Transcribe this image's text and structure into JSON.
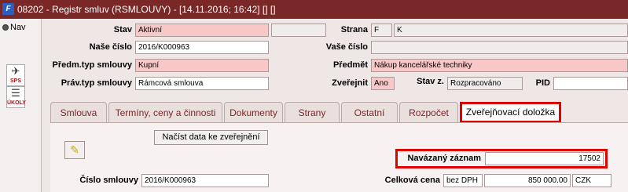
{
  "window": {
    "app_icon": "F",
    "title": "08202 - Registr smluv (RSMLOUVY) - [14.11.2016; 16:42] [] []"
  },
  "left": {
    "nav_label": "Nav",
    "tools": [
      {
        "icon": "sps-icon",
        "label": "SPS"
      },
      {
        "icon": "tasks-icon",
        "label": "ÚKOLY"
      }
    ]
  },
  "form": {
    "stav": {
      "label": "Stav",
      "value": "Aktivní",
      "extra": ""
    },
    "strana": {
      "label": "Strana",
      "code": "F",
      "value": "K"
    },
    "nase_cislo": {
      "label": "Naše číslo",
      "value": "2016/K000963"
    },
    "vase_cislo": {
      "label": "Vaše číslo",
      "value": ""
    },
    "predm_typ": {
      "label": "Předm.typ smlouvy",
      "value": "Kupní"
    },
    "predmet": {
      "label": "Předmět",
      "value": "Nákup kancelářské techniky"
    },
    "prav_typ": {
      "label": "Práv.typ smlouvy",
      "value": "Rámcová smlouva"
    },
    "zverejnit": {
      "label": "Zveřejnit",
      "value": "Ano"
    },
    "stav_z": {
      "label": "Stav z.",
      "value": "Rozpracováno"
    },
    "pid": {
      "label": "PID",
      "value": ""
    }
  },
  "tabs": [
    {
      "label": "Smlouva",
      "active": false
    },
    {
      "label": "Termíny, ceny a činnosti",
      "active": false
    },
    {
      "label": "Dokumenty",
      "active": false
    },
    {
      "label": "Strany",
      "active": false
    },
    {
      "label": "Ostatní",
      "active": false
    },
    {
      "label": "Rozpočet",
      "active": false
    },
    {
      "label": "Zveřejňovací doložka",
      "active": true
    }
  ],
  "panel": {
    "load_button": "Načíst data ke zveřejnění",
    "key_icon": "key-icon",
    "navazany": {
      "label": "Navázaný záznam",
      "value": "17502"
    },
    "cislo_smlouvy": {
      "label": "Číslo smlouvy",
      "value": "2016/K000963"
    },
    "celkova_cena": {
      "label": "Celková cena",
      "vat": "bez DPH",
      "value": "850 000.00",
      "currency": "CZK"
    }
  },
  "colors": {
    "titlebar": "#7a2727",
    "required_field": "#f8c8c8",
    "highlight": "#e00000"
  }
}
